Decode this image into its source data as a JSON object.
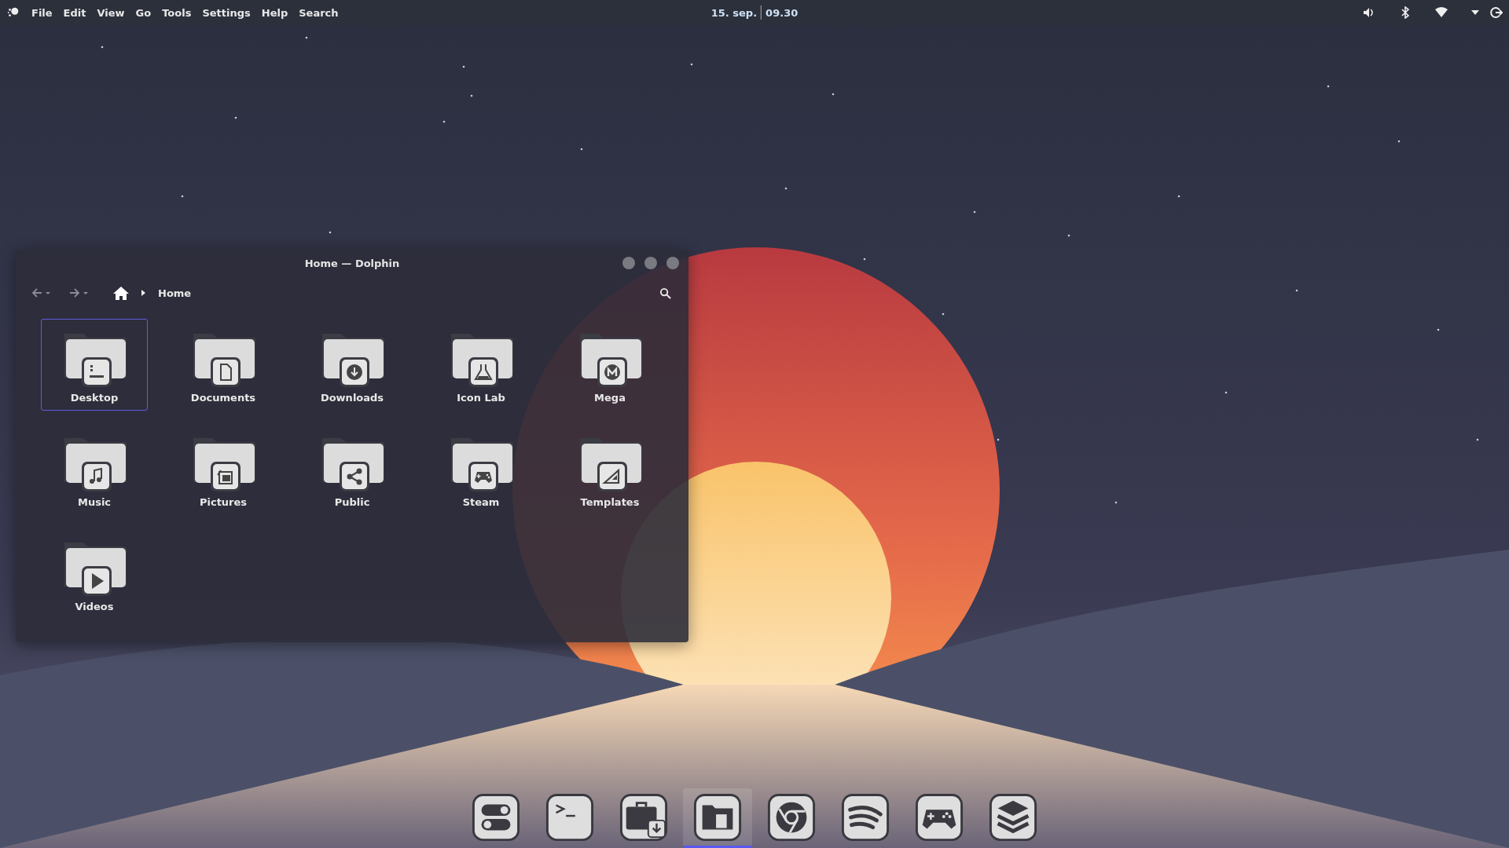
{
  "top_bar": {
    "menu": [
      "File",
      "Edit",
      "View",
      "Go",
      "Tools",
      "Settings",
      "Help",
      "Search"
    ],
    "date": "15. sep.",
    "time": "09.30"
  },
  "window": {
    "title": "Home — Dolphin",
    "breadcrumb": "Home",
    "folders": [
      {
        "name": "Desktop",
        "kind": "desktop",
        "selected": true
      },
      {
        "name": "Documents",
        "kind": "document",
        "selected": false
      },
      {
        "name": "Downloads",
        "kind": "download",
        "selected": false
      },
      {
        "name": "Icon Lab",
        "kind": "flask",
        "selected": false
      },
      {
        "name": "Mega",
        "kind": "mega",
        "selected": false
      },
      {
        "name": "Music",
        "kind": "music",
        "selected": false
      },
      {
        "name": "Pictures",
        "kind": "pictures",
        "selected": false
      },
      {
        "name": "Public",
        "kind": "share",
        "selected": false
      },
      {
        "name": "Steam",
        "kind": "gamepad",
        "selected": false
      },
      {
        "name": "Templates",
        "kind": "template",
        "selected": false
      },
      {
        "name": "Videos",
        "kind": "video",
        "selected": false
      }
    ]
  },
  "dock": [
    {
      "kind": "toggles",
      "selected": false
    },
    {
      "kind": "terminal",
      "selected": false
    },
    {
      "kind": "installer",
      "selected": false
    },
    {
      "kind": "files",
      "selected": true
    },
    {
      "kind": "browser",
      "selected": false
    },
    {
      "kind": "music",
      "selected": false
    },
    {
      "kind": "games",
      "selected": false
    },
    {
      "kind": "layers",
      "selected": false
    }
  ]
}
